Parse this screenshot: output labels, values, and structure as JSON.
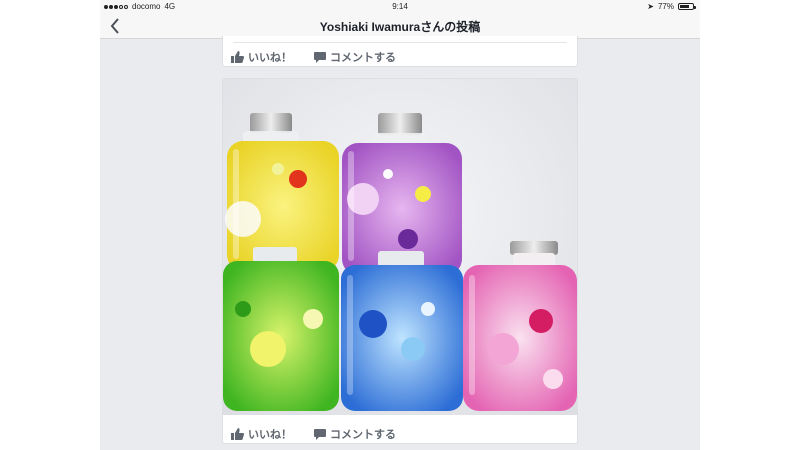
{
  "status_bar": {
    "carrier": "docomo",
    "network": "4G",
    "time": "9:14",
    "battery": "77%",
    "battery_level": 0.77
  },
  "nav": {
    "title": "Yoshiaki Iwamuraさんの投稿",
    "back_icon": "chevron-left-icon"
  },
  "posts": [
    {
      "like_label": "いいね！",
      "comment_label": "コメントする"
    },
    {
      "like_label": "いいね！",
      "comment_label": "コメントする"
    }
  ],
  "photo": {
    "description_icon": "herbarium-bottles-photo",
    "colors": [
      "#f3e23a",
      "#7a1fa2",
      "#f2a0d7",
      "#5ad02a",
      "#2f78e0",
      "#e0318c"
    ]
  },
  "colors": {
    "background": "#e9ebee",
    "text_gray": "#606770",
    "bar": "#f7f7f7"
  }
}
